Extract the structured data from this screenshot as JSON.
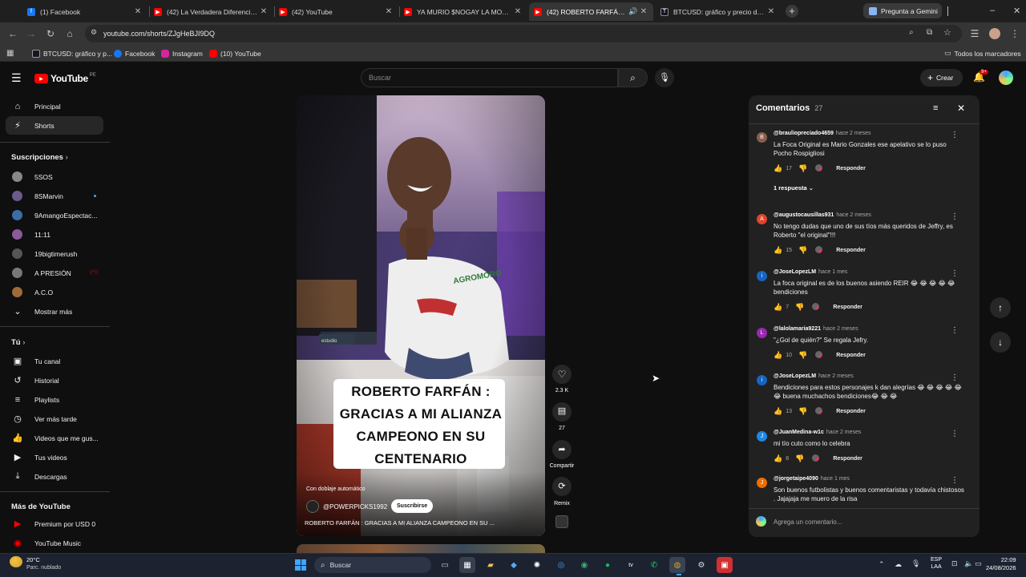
{
  "browser": {
    "tabs": [
      {
        "title": "(1) Facebook",
        "icon": "facebook-icon",
        "color": "#1877f2"
      },
      {
        "title": "(42) La Verdadera Diferencia Entre...",
        "icon": "youtube-icon",
        "color": "#ff0000"
      },
      {
        "title": "(42) YouTube",
        "icon": "youtube-icon",
        "color": "#ff0000"
      },
      {
        "title": "YA MURIO $NOGAY LA MONEDA...",
        "icon": "youtube-icon",
        "color": "#ff0000"
      },
      {
        "title": "(42) ROBERTO FARFÁN : GRAC...",
        "icon": "youtube-icon",
        "color": "#ff0000"
      },
      {
        "title": "BTCUSD: gráfico y precio del Bitcoin",
        "icon": "tradingview-icon",
        "color": "#131722"
      }
    ],
    "gemini_label": "Pregunta a Gemini",
    "url": "youtube.com/shorts/ZJgHeBJI9DQ",
    "bookmarks": [
      {
        "label": "BTCUSD: gráfico y p...",
        "color": "#131722"
      },
      {
        "label": "Facebook",
        "color": "#1877f2"
      },
      {
        "label": "Instagram",
        "color": "#d6249f"
      },
      {
        "label": "(10) YouTube",
        "color": "#ff0000"
      }
    ],
    "all_bookmarks": "Todos los marcadores"
  },
  "youtube": {
    "logo_text": "YouTube",
    "country": "PE",
    "search_placeholder": "Buscar",
    "create_label": "Crear",
    "notif_count": "9+",
    "nav_primary": [
      {
        "label": "Principal",
        "icon": "home-icon"
      },
      {
        "label": "Shorts",
        "icon": "shorts-icon"
      }
    ],
    "subs_title": "Suscripciones",
    "subscriptions": [
      {
        "label": "5SOS",
        "color": "#888888"
      },
      {
        "label": "8SMarvin",
        "color": "#6b5a8a",
        "dot": "#3ea6ff"
      },
      {
        "label": "9AmangoEspectac...",
        "color": "#3a6ea5"
      },
      {
        "label": "11:11",
        "color": "#8a5a9a"
      },
      {
        "label": "19bigtimerush",
        "color": "#555555"
      },
      {
        "label": "A PRESIÓN",
        "color": "#777777",
        "live": true
      },
      {
        "label": "A.C.O",
        "color": "#a06a3a"
      }
    ],
    "show_more": "Mostrar más",
    "you_title": "Tú",
    "you_items": [
      {
        "label": "Tu canal",
        "icon": "channel-icon"
      },
      {
        "label": "Historial",
        "icon": "history-icon"
      },
      {
        "label": "Playlists",
        "icon": "playlists-icon"
      },
      {
        "label": "Ver más tarde",
        "icon": "watch-later-icon"
      },
      {
        "label": "Videos que me gus...",
        "icon": "like-icon"
      },
      {
        "label": "Tus videos",
        "icon": "videos-icon"
      },
      {
        "label": "Descargas",
        "icon": "download-icon"
      }
    ],
    "more_title": "Más de YouTube",
    "more_items": [
      {
        "label": "Premium por USD 0",
        "icon": "premium-icon"
      },
      {
        "label": "YouTube Music",
        "icon": "music-icon"
      }
    ]
  },
  "short": {
    "caption_lines": [
      "ROBERTO FARFÁN :",
      "GRACIAS A MI ALIANZA",
      "CAMPEONO EN SU",
      "CENTENARIO"
    ],
    "auto_dub": "Con doblaje automático",
    "channel": "@POWERPICKS1992",
    "subscribe": "Suscribirse",
    "title": "ROBERTO FARFÁN : GRACIAS A MI ALIANZA CAMPEONO EN SU ...",
    "likes": "2.3 K",
    "comments_count": "27",
    "share": "Compartir",
    "remix": "Remix",
    "shirt_text": "AGROMORO",
    "studio_sign": "estudio"
  },
  "comments_panel": {
    "title": "Comentarios",
    "count": "27",
    "add_placeholder": "Agrega un comentario...",
    "reply_label": "Responder",
    "items": [
      {
        "user": "@brauliopreciado4659",
        "time": "hace 2 meses",
        "text": "La Foca Original es Mario Gonzales ese apelativo se lo puso Pocho Rospigliosi",
        "likes": "17",
        "avatar": "#8b5e4f",
        "initial": "B",
        "replies": "1 respuesta"
      },
      {
        "user": "@augustocausillas931",
        "time": "hace 2 meses",
        "text": "No tengo dudas que uno de sus tíos más queridos de Jeffry, es Roberto \"el original\"!!!",
        "likes": "15",
        "avatar": "#e0452c",
        "initial": "A"
      },
      {
        "user": "@JoseLopezLM",
        "time": "hace 1 mes",
        "text": "La foca original es de los buenos asiendo REIR 😂 😂 😂 😂 😂 bendiciones",
        "likes": "7",
        "avatar": "#1565c0",
        "initial": "i"
      },
      {
        "user": "@lalolamaria9221",
        "time": "hace 2 meses",
        "text": "\"¿Gol de quién?\" Se regala Jefry.",
        "likes": "10",
        "avatar": "#9c27b0",
        "initial": "L"
      },
      {
        "user": "@JoseLopezLM",
        "time": "hace 2 meses",
        "text": "Bendiciones para estos personajes k dan alegrías 😂 😂 😂 😂 😂 😂 buena muchachos bendiciones😂 😂 😂",
        "likes": "13",
        "avatar": "#1565c0",
        "initial": "i"
      },
      {
        "user": "@JuanMedina-w1c",
        "time": "hace 2 meses",
        "text": "mi tío cuto como lo celebra",
        "likes": "8",
        "avatar": "#1e88e5",
        "initial": "J"
      },
      {
        "user": "@jorgetaipe4090",
        "time": "hace 1 mes",
        "text": "Son buenos futbolistas y buenos comentaristas y todavía chistosos . Jajajaja me muero de la risa",
        "likes": "",
        "avatar": "#ef6c00",
        "initial": "J"
      }
    ]
  },
  "taskbar": {
    "weather_temp": "20°C",
    "weather_desc": "Parc. nublado",
    "search_label": "Buscar",
    "lang": "ESP",
    "lang2": "LAA",
    "time": "22:09",
    "date": "24/08/2026"
  }
}
